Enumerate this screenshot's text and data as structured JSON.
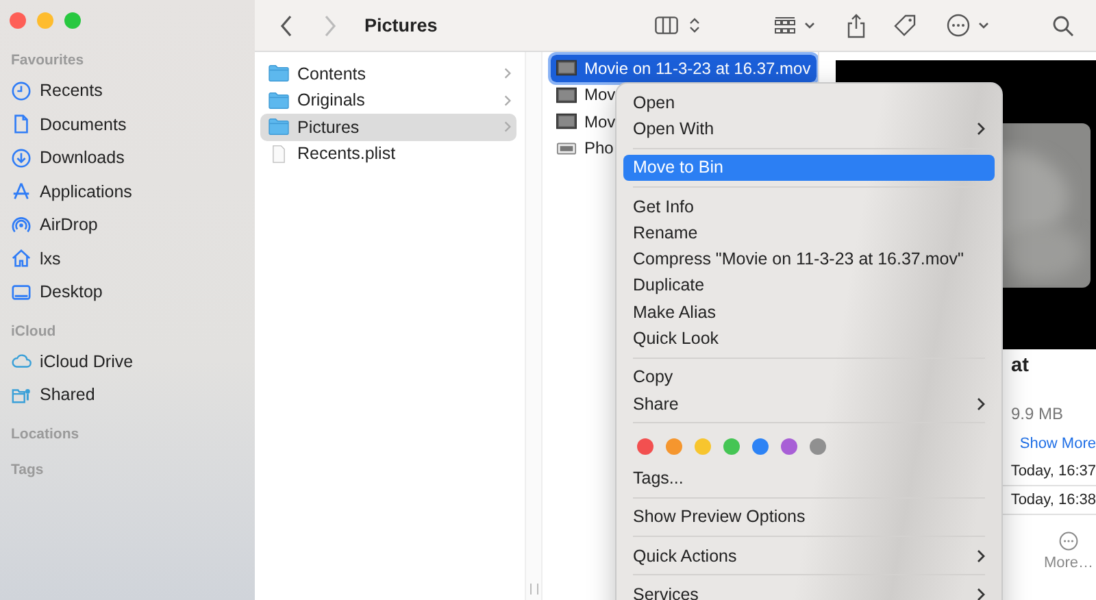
{
  "window": {
    "title": "Pictures"
  },
  "toolbar": {
    "back": {
      "disabled": false
    },
    "forward": {
      "disabled": true
    }
  },
  "sidebar": {
    "sections": [
      {
        "title": "Favourites",
        "items": [
          {
            "label": "Recents",
            "kind": "clock"
          },
          {
            "label": "Documents",
            "kind": "document"
          },
          {
            "label": "Downloads",
            "kind": "download"
          },
          {
            "label": "Applications",
            "kind": "apps"
          },
          {
            "label": "AirDrop",
            "kind": "airdrop"
          },
          {
            "label": "lxs",
            "kind": "home"
          },
          {
            "label": "Desktop",
            "kind": "desktop"
          }
        ]
      },
      {
        "title": "iCloud",
        "items": [
          {
            "label": "iCloud Drive",
            "kind": "cloud"
          },
          {
            "label": "Shared",
            "kind": "shared"
          }
        ]
      },
      {
        "title": "Locations"
      },
      {
        "title": "Tags"
      }
    ]
  },
  "column_1": [
    {
      "label": "Contents",
      "kind": "folder",
      "selected": false
    },
    {
      "label": "Originals",
      "kind": "folder",
      "selected": false
    },
    {
      "label": "Pictures",
      "kind": "folder",
      "selected": true
    },
    {
      "label": "Recents.plist",
      "kind": "file",
      "selected": false
    }
  ],
  "column_2": [
    {
      "label": "Movie on 11-3-23 at 16.37.mov",
      "kind": "movie",
      "selected": true
    },
    {
      "label": "Mov",
      "kind": "movie",
      "selected": false
    },
    {
      "label": "Mov",
      "kind": "movie",
      "selected": false
    },
    {
      "label": "Pho",
      "selected": false
    }
  ],
  "preview": {
    "title": "at",
    "size": "9.9 MB",
    "show_more": "Show More",
    "dates": [
      "Today, 16:37",
      "Today, 16:38"
    ],
    "more_button": "More…"
  },
  "context_menu": [
    {
      "kind": "item",
      "label": "Open",
      "submenu": false,
      "selected": false
    },
    {
      "kind": "item",
      "label": "Open With",
      "submenu": true,
      "selected": false
    },
    {
      "kind": "separator"
    },
    {
      "kind": "item",
      "label": "Move to Bin",
      "submenu": false,
      "selected": true
    },
    {
      "kind": "separator"
    },
    {
      "kind": "item",
      "label": "Get Info",
      "submenu": false,
      "selected": false
    },
    {
      "kind": "item",
      "label": "Rename",
      "submenu": false,
      "selected": false
    },
    {
      "kind": "item",
      "label": "Compress \"Movie on 11-3-23 at 16.37.mov\"",
      "submenu": false,
      "selected": false
    },
    {
      "kind": "item",
      "label": "Duplicate",
      "submenu": false,
      "selected": false
    },
    {
      "kind": "item",
      "label": "Make Alias",
      "submenu": false,
      "selected": false
    },
    {
      "kind": "item",
      "label": "Quick Look",
      "submenu": false,
      "selected": false
    },
    {
      "kind": "separator"
    },
    {
      "kind": "item",
      "label": "Copy",
      "submenu": false,
      "selected": false
    },
    {
      "kind": "item",
      "label": "Share",
      "submenu": true,
      "selected": false
    },
    {
      "kind": "separator"
    },
    {
      "kind": "tags",
      "tags": [
        {
          "color": "#f25050"
        },
        {
          "color": "#f5962e"
        },
        {
          "color": "#f7c52e"
        },
        {
          "color": "#45c554"
        },
        {
          "color": "#2d83f5"
        },
        {
          "color": "#a85fd6"
        },
        {
          "color": "#909090"
        }
      ]
    },
    {
      "kind": "item",
      "label": "Tags...",
      "submenu": false,
      "selected": false
    },
    {
      "kind": "separator"
    },
    {
      "kind": "item",
      "label": "Show Preview Options",
      "submenu": false,
      "selected": false
    },
    {
      "kind": "separator"
    },
    {
      "kind": "item",
      "label": "Quick Actions",
      "submenu": true,
      "selected": false
    },
    {
      "kind": "separator"
    },
    {
      "kind": "item",
      "label": "Services",
      "submenu": true,
      "selected": false
    }
  ]
}
